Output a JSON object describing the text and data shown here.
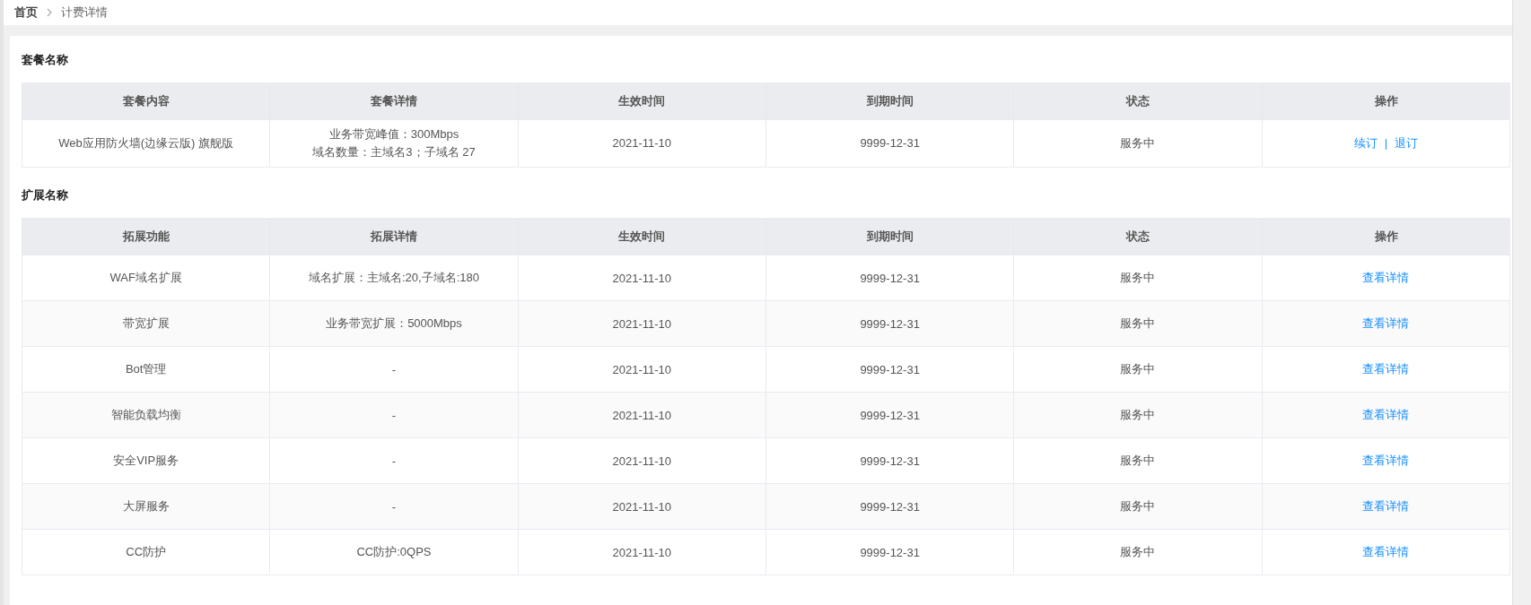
{
  "breadcrumb": {
    "items": [
      "首页",
      "计费详情"
    ]
  },
  "package": {
    "title": "套餐名称",
    "columns": [
      "套餐内容",
      "套餐详情",
      "生效时间",
      "到期时间",
      "状态",
      "操作"
    ],
    "rows": [
      {
        "name": "Web应用防火墙(边缘云版) 旗舰版",
        "details": [
          "业务带宽峰值：300Mbps",
          "域名数量：主域名3；子域名 27"
        ],
        "start": "2021-11-10",
        "end": "9999-12-31",
        "status": "服务中",
        "actions": [
          "续订",
          "退订"
        ],
        "separator": "|"
      }
    ]
  },
  "extensions": {
    "title": "扩展名称",
    "columns": [
      "拓展功能",
      "拓展详情",
      "生效时间",
      "到期时间",
      "状态",
      "操作"
    ],
    "rows": [
      {
        "name": "WAF域名扩展",
        "detail": "域名扩展：主域名:20,子域名:180",
        "start": "2021-11-10",
        "end": "9999-12-31",
        "status": "服务中",
        "action": "查看详情"
      },
      {
        "name": "带宽扩展",
        "detail": "业务带宽扩展：5000Mbps",
        "start": "2021-11-10",
        "end": "9999-12-31",
        "status": "服务中",
        "action": "查看详情"
      },
      {
        "name": "Bot管理",
        "detail": "-",
        "start": "2021-11-10",
        "end": "9999-12-31",
        "status": "服务中",
        "action": "查看详情"
      },
      {
        "name": "智能负载均衡",
        "detail": "-",
        "start": "2021-11-10",
        "end": "9999-12-31",
        "status": "服务中",
        "action": "查看详情"
      },
      {
        "name": "安全VIP服务",
        "detail": "-",
        "start": "2021-11-10",
        "end": "9999-12-31",
        "status": "服务中",
        "action": "查看详情"
      },
      {
        "name": "大屏服务",
        "detail": "-",
        "start": "2021-11-10",
        "end": "9999-12-31",
        "status": "服务中",
        "action": "查看详情"
      },
      {
        "name": "CC防护",
        "detail": "CC防护:0QPS",
        "start": "2021-11-10",
        "end": "9999-12-31",
        "status": "服务中",
        "action": "查看详情"
      }
    ]
  }
}
